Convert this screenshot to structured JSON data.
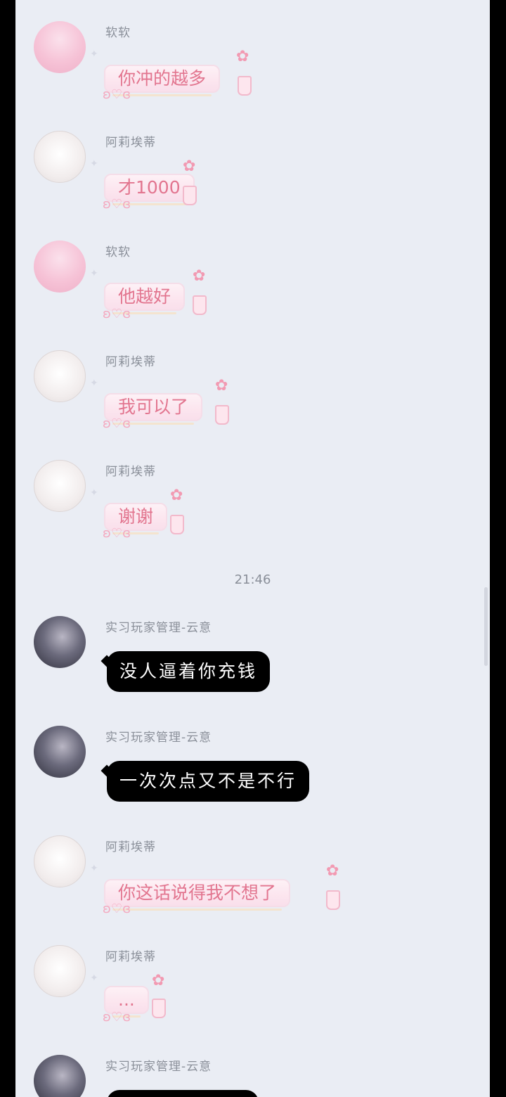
{
  "messages": [
    {
      "sender": "软软",
      "text": "你冲的越多"
    },
    {
      "sender": "阿莉埃蒂",
      "text": "才1000"
    },
    {
      "sender": "软软",
      "text": "他越好"
    },
    {
      "sender": "阿莉埃蒂",
      "text": "我可以了"
    },
    {
      "sender": "阿莉埃蒂",
      "text": "谢谢"
    },
    {
      "sender": "实习玩家管理-云意",
      "text": "没人逼着你充钱"
    },
    {
      "sender": "实习玩家管理-云意",
      "text": "一次次点又不是不行"
    },
    {
      "sender": "阿莉埃蒂",
      "text": "你这话说得我不想了"
    },
    {
      "sender": "阿莉埃蒂",
      "text": "..."
    },
    {
      "sender": "实习玩家管理-云意",
      "text": ""
    }
  ],
  "timestamp": "21:46",
  "icons": {
    "bubble_decoration": "flower-cup-icon",
    "bunny": "bunny-icon"
  },
  "colors": {
    "background": "#eaedf4",
    "cute_bubble_text": "#e2758f",
    "dark_bubble": "#000000",
    "dark_bubble_text": "#ffffff"
  }
}
